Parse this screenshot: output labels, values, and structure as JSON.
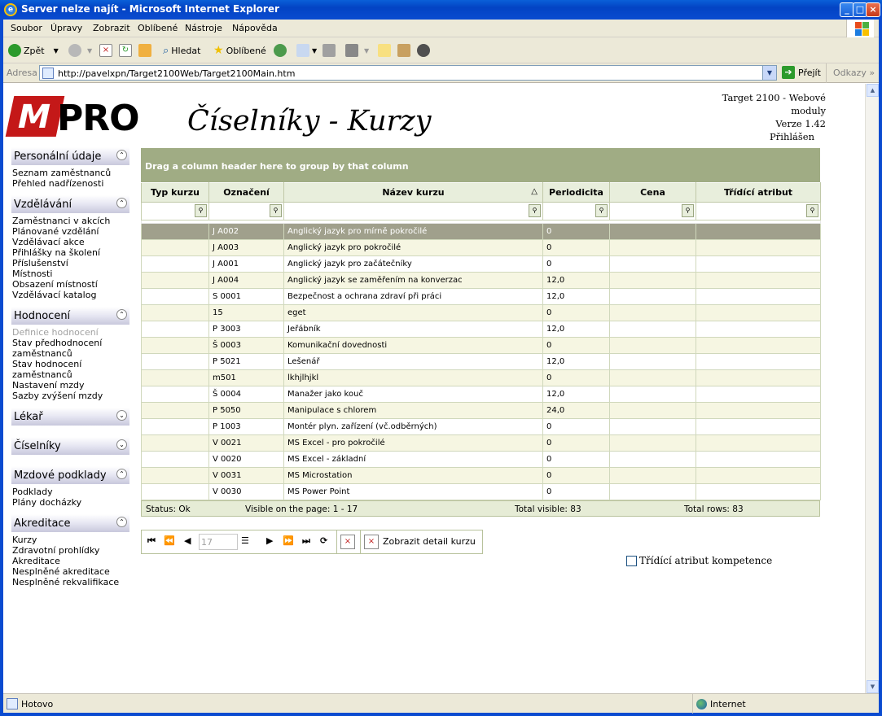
{
  "window": {
    "title": "Server nelze najít - Microsoft Internet Explorer"
  },
  "menu": [
    "Soubor",
    "Úpravy",
    "Zobrazit",
    "Oblíbené",
    "Nástroje",
    "Nápověda"
  ],
  "toolbar": {
    "back": "Zpět",
    "search": "Hledat",
    "favorites": "Oblíbené"
  },
  "address": {
    "label": "Adresa",
    "url": "http://pavelxpn/Target2100Web/Target2100Main.htm",
    "go": "Přejít",
    "links": "Odkazy"
  },
  "header": {
    "logo_text": "PRO",
    "page_title": "Číselníky - Kurzy",
    "app_name": "Target 2100 - Webové moduly",
    "version": "Verze 1.42",
    "login": "Přihlášen"
  },
  "sidebar": [
    {
      "title": "Personální údaje",
      "items": [
        "Seznam zaměstnanců",
        "Přehled nadřízenosti"
      ]
    },
    {
      "title": "Vzdělávání",
      "items": [
        "Zaměstnanci v akcích",
        "Plánované vzdělání",
        "Vzdělávací akce",
        "Přihlášky na školení",
        "Příslušenství",
        "Místnosti",
        "Obsazení místností",
        "Vzdělávací katalog"
      ]
    },
    {
      "title": "Hodnocení",
      "items": [
        "Definice hodnocení",
        "Stav předhodnocení zaměstnanců",
        "Stav hodnocení zaměstnanců",
        "Nastavení mzdy",
        "Sazby zvýšení mzdy"
      ]
    },
    {
      "title": "Lékař",
      "items": []
    },
    {
      "title": "Číselníky",
      "items": []
    },
    {
      "title": "Mzdové podklady",
      "items": [
        "Podklady",
        "Plány docházky"
      ]
    },
    {
      "title": "Akreditace",
      "items": [
        "Kurzy",
        "Zdravotní prohlídky",
        "Akreditace",
        "Nesplněné akreditace",
        "Nesplněné rekvalifikace"
      ]
    }
  ],
  "grid": {
    "group_hint": "Drag a column header here to group by that column",
    "columns": [
      "Typ kurzu",
      "Označení",
      "Název kurzu",
      "Periodicita",
      "Cena",
      "Třídící atribut"
    ],
    "rows": [
      [
        "",
        "J A002",
        "Anglický jazyk pro mírně pokročilé",
        "0",
        "",
        ""
      ],
      [
        "",
        "J A003",
        "Anglický jazyk pro pokročilé",
        "0",
        "",
        ""
      ],
      [
        "",
        "J A001",
        "Anglický jazyk pro začátečníky",
        "0",
        "",
        ""
      ],
      [
        "",
        "J A004",
        "Anglický jazyk se zaměřením na konverzac",
        "12,0",
        "",
        ""
      ],
      [
        "",
        "S 0001",
        "Bezpečnost a ochrana zdraví při práci",
        "12,0",
        "",
        ""
      ],
      [
        "",
        "15",
        "eget",
        "0",
        "",
        ""
      ],
      [
        "",
        "P 3003",
        "Jeřábník",
        "12,0",
        "",
        ""
      ],
      [
        "",
        "Š 0003",
        "Komunikační dovednosti",
        "0",
        "",
        ""
      ],
      [
        "",
        "P 5021",
        "Lešenář",
        "12,0",
        "",
        ""
      ],
      [
        "",
        "m501",
        "lkhjlhjkl",
        "0",
        "",
        ""
      ],
      [
        "",
        "Š 0004",
        "Manažer jako kouč",
        "12,0",
        "",
        ""
      ],
      [
        "",
        "P 5050",
        "Manipulace s chlorem",
        "24,0",
        "",
        ""
      ],
      [
        "",
        "P 1003",
        "Montér plyn. zařízení (vč.odběrných)",
        "0",
        "",
        ""
      ],
      [
        "",
        "V 0021",
        "MS Excel - pro pokročilé",
        "0",
        "",
        ""
      ],
      [
        "",
        "V 0020",
        "MS Excel - základní",
        "0",
        "",
        ""
      ],
      [
        "",
        "V 0031",
        "MS Microstation",
        "0",
        "",
        ""
      ],
      [
        "",
        "V 0030",
        "MS Power Point",
        "0",
        "",
        ""
      ]
    ],
    "status": "Status: Ok",
    "visible_on_page": "Visible on the page: 1 - 17",
    "total_visible": "Total visible: 83",
    "total_rows": "Total rows: 83"
  },
  "pager": {
    "page": "17",
    "detail_label": "Zobrazit detail kurzu"
  },
  "checkbox_label": "Třídící atribut kompetence",
  "statusbar": {
    "left": "Hotovo",
    "right": "Internet"
  }
}
